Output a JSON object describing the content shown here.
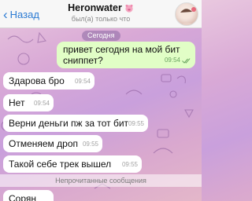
{
  "header": {
    "back_label": "Назад",
    "contact_name": "Heronwater",
    "status": "был(а) только что"
  },
  "chat": {
    "date_label": "Сегодня",
    "outgoing": {
      "text_line1": "привет сегодня на мой бит",
      "text_line2": "сниппет?",
      "time": "09:54"
    },
    "incoming": [
      {
        "text": "Здарова бро",
        "time": "09:54"
      },
      {
        "text": "Нет",
        "time": "09:54"
      },
      {
        "text": "Верни деньги пж за тот бит",
        "time": "09:55"
      },
      {
        "text": "Отменяем дроп",
        "time": "09:55"
      },
      {
        "text": "Такой себе трек вышел",
        "time": "09:55"
      }
    ],
    "unread_label": "Непрочитанные сообщения",
    "partial": {
      "text": "Сорян"
    }
  },
  "colors": {
    "accent": "#2c7bd3",
    "outgoing_bubble": "#e1fec6",
    "incoming_bubble": "#ffffff"
  }
}
